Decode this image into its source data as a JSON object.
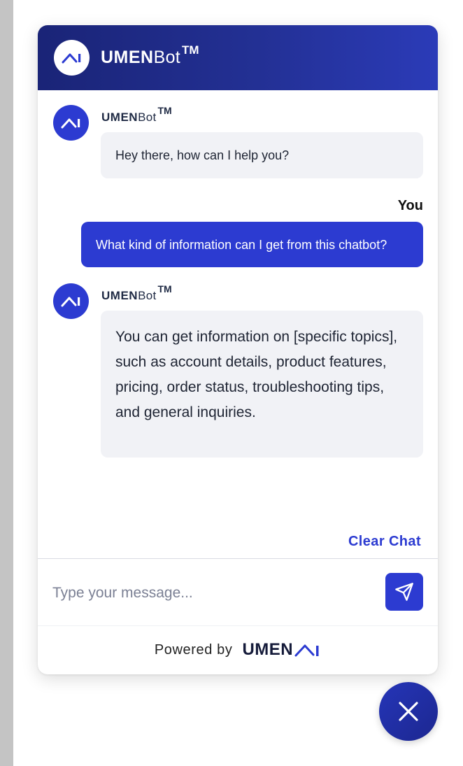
{
  "header": {
    "brand_bold": "UMEN",
    "brand_light": "Bot",
    "trademark": "TM"
  },
  "messages": [
    {
      "sender": "bot",
      "name_bold": "UMEN",
      "name_light": "Bot",
      "trademark": "TM",
      "text": "Hey there, how can I help you?"
    },
    {
      "sender": "user",
      "name": "You",
      "text": "What kind of information can I get from this chatbot?"
    },
    {
      "sender": "bot",
      "name_bold": "UMEN",
      "name_light": "Bot",
      "trademark": "TM",
      "text": "You can get information on [specific topics], such as account details, product features, pricing, order status, troubleshooting tips, and general inquiries."
    }
  ],
  "clear_chat_label": "Clear Chat",
  "input": {
    "placeholder": "Type your message...",
    "value": ""
  },
  "footer": {
    "powered_by": "Powered by",
    "logo_text": "UMEN",
    "logo_suffix": "AI"
  },
  "icons": {
    "logo": "umen-ai-logo-icon",
    "send": "send-icon",
    "close": "close-icon"
  },
  "colors": {
    "header_start": "#1a2477",
    "header_end": "#2b3bb8",
    "accent": "#2c3bd1",
    "bot_bubble": "#f1f2f6",
    "user_bubble": "#2c3bd1",
    "fab": "#2131a8"
  }
}
